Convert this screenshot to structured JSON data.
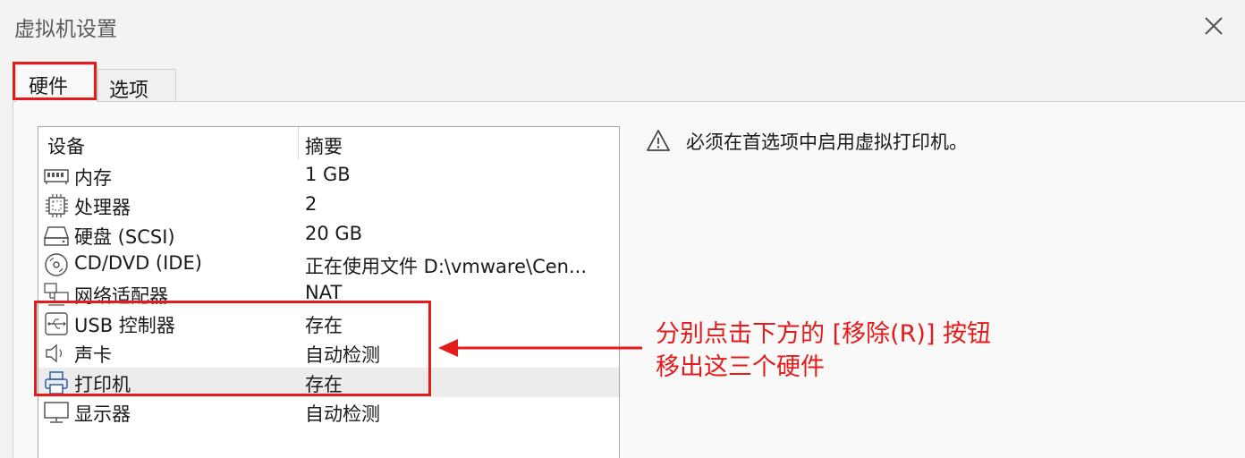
{
  "window": {
    "title": "虚拟机设置"
  },
  "tabs": [
    {
      "label": "硬件",
      "active": true
    },
    {
      "label": "选项",
      "active": false
    }
  ],
  "device_list": {
    "header_device": "设备",
    "header_summary": "摘要",
    "rows": [
      {
        "name": "内存",
        "summary": "1 GB",
        "icon": "memory-icon"
      },
      {
        "name": "处理器",
        "summary": "2",
        "icon": "cpu-icon"
      },
      {
        "name": "硬盘 (SCSI)",
        "summary": "20 GB",
        "icon": "hard-disk-icon"
      },
      {
        "name": "CD/DVD (IDE)",
        "summary": "正在使用文件 D:\\vmware\\Cen...",
        "icon": "cd-dvd-icon"
      },
      {
        "name": "网络适配器",
        "summary": "NAT",
        "icon": "network-adapter-icon"
      },
      {
        "name": "USB 控制器",
        "summary": "存在",
        "icon": "usb-icon"
      },
      {
        "name": "声卡",
        "summary": "自动检测",
        "icon": "sound-card-icon"
      },
      {
        "name": "打印机",
        "summary": "存在",
        "icon": "printer-icon",
        "selected": true
      },
      {
        "name": "显示器",
        "summary": "自动检测",
        "icon": "monitor-icon"
      }
    ]
  },
  "warning": {
    "icon": "warning-icon",
    "text": "必须在首选项中启用虚拟打印机。"
  },
  "annotation": {
    "line1": "分别点击下方的 [移除(R)] 按钮",
    "line2": "移出这三个硬件",
    "color": "#e41b1b"
  }
}
